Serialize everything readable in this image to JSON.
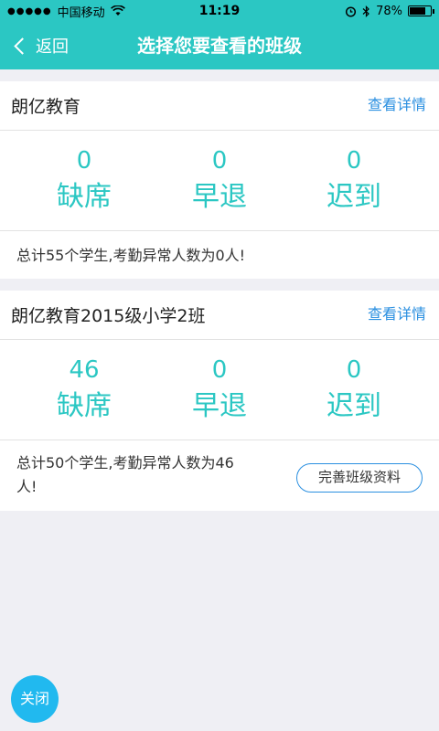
{
  "status_bar": {
    "carrier": "中国移动",
    "time": "11:19",
    "battery_percent": "78%",
    "battery_level": 0.78
  },
  "nav": {
    "back_label": "返回",
    "title": "选择您要查看的班级"
  },
  "classes": [
    {
      "name": "朗亿教育",
      "detail_label": "查看详情",
      "absent_value": "0",
      "absent_label": "缺席",
      "early_value": "0",
      "early_label": "早退",
      "late_value": "0",
      "late_label": "迟到",
      "summary": "总计55个学生,考勤异常人数为0人!"
    },
    {
      "name": "朗亿教育2015级小学2班",
      "detail_label": "查看详情",
      "absent_value": "46",
      "absent_label": "缺席",
      "early_value": "0",
      "early_label": "早退",
      "late_value": "0",
      "late_label": "迟到",
      "summary_line1": "总计50个学生,考勤异常人数为46",
      "summary_line2": "人!",
      "complete_label": "完善班级资料"
    }
  ],
  "close_label": "关闭",
  "colors": {
    "accent": "#2bc7c3",
    "link": "#2a8fe0",
    "close_button": "#21b9ef",
    "background": "#efeff4"
  }
}
